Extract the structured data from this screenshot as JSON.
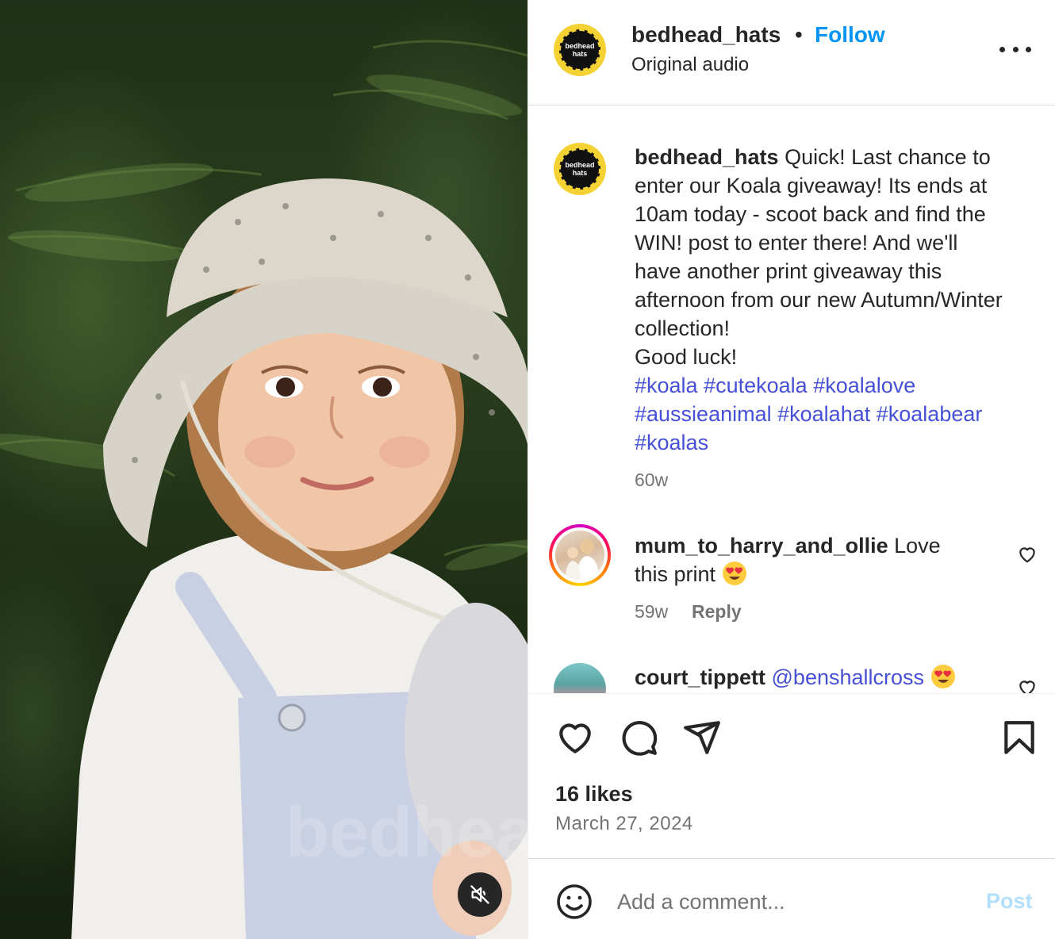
{
  "post": {
    "username": "bedhead_hats",
    "follow_label": "Follow",
    "separator": "•",
    "audio_label": "Original audio",
    "avatar_text_line1": "bedhead",
    "avatar_text_line2": "hats",
    "video_watermark": "bedhead"
  },
  "caption": {
    "username": "bedhead_hats",
    "lines": [
      "Quick! Last chance to",
      "enter our Koala giveaway! Its ends at",
      "10am today - scoot back and find the",
      "WIN! post to enter there! And we'll",
      "have another print giveaway this",
      "afternoon from our new Autumn/Winter",
      "collection!",
      "Good luck!"
    ],
    "hashtags": [
      "#koala",
      "#cutekoala",
      "#koalalove",
      "#aussieanimal",
      "#koalahat",
      "#koalabear",
      "#koalas"
    ],
    "age": "60w"
  },
  "comments": [
    {
      "username": "mum_to_harry_and_ollie",
      "text_line1": "Love",
      "text_line2": "this print",
      "emoji": "heart-eyes",
      "age": "59w",
      "reply_label": "Reply"
    },
    {
      "username": "court_tippett",
      "mention": "@benshallcross",
      "emoji": "heart-eyes"
    }
  ],
  "actions": {
    "likes": "16 likes",
    "date": "March 27, 2024",
    "icons": [
      "heart-icon",
      "comment-icon",
      "share-icon",
      "bookmark-icon"
    ]
  },
  "composer": {
    "placeholder": "Add a comment...",
    "post_label": "Post"
  },
  "media": {
    "mute_icon": "speaker-muted-icon"
  },
  "colors": {
    "link_blue": "#0095f6",
    "hashtag_blue": "#4650d6",
    "muted_text": "#737373",
    "post_disabled": "#b2dffc",
    "avatar_yellow": "#f5d233"
  }
}
